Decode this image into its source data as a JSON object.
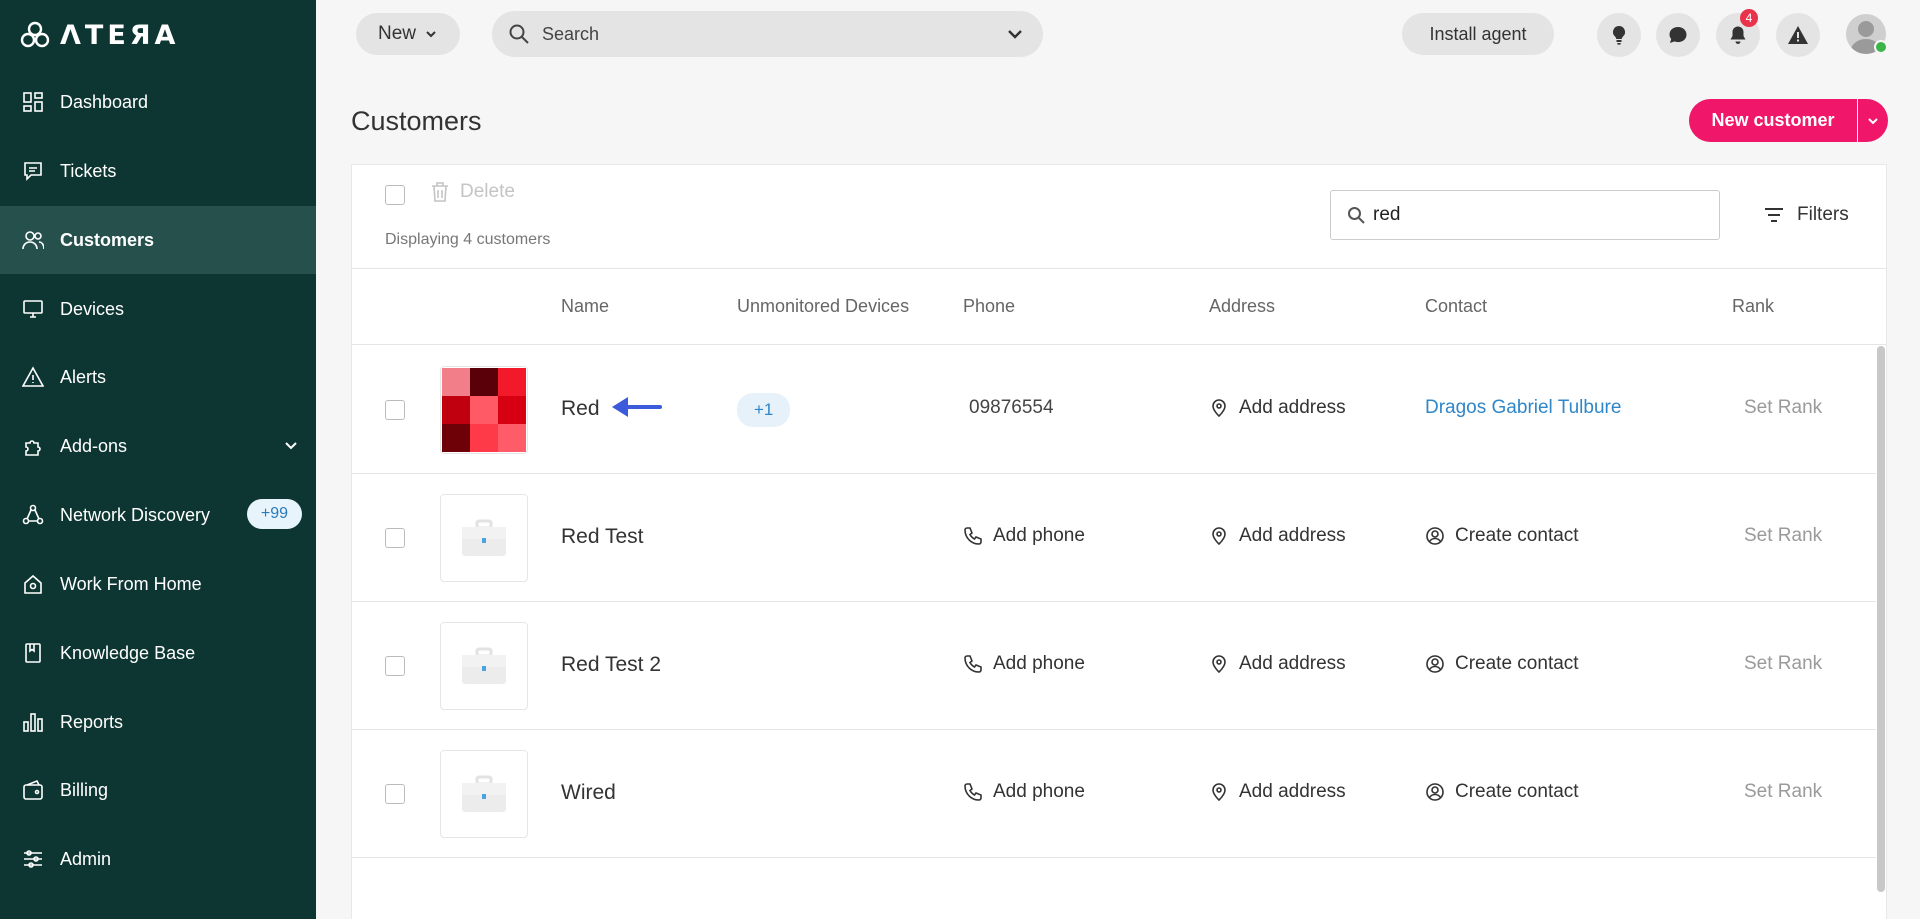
{
  "sidebar": {
    "brand": "ΛTEЯA",
    "items": [
      {
        "label": "Dashboard"
      },
      {
        "label": "Tickets"
      },
      {
        "label": "Customers"
      },
      {
        "label": "Devices"
      },
      {
        "label": "Alerts"
      },
      {
        "label": "Add-ons"
      },
      {
        "label": "Network Discovery",
        "badge": "+99"
      },
      {
        "label": "Work From Home"
      },
      {
        "label": "Knowledge Base"
      },
      {
        "label": "Reports"
      },
      {
        "label": "Billing"
      },
      {
        "label": "Admin"
      }
    ]
  },
  "topbar": {
    "new_label": "New",
    "search_placeholder": "Search",
    "install_label": "Install agent",
    "notif_count": "4"
  },
  "page": {
    "title": "Customers",
    "new_customer_label": "New customer"
  },
  "toolbar": {
    "delete_label": "Delete",
    "displaying": "Displaying 4 customers",
    "search_value": "red",
    "filters_label": "Filters"
  },
  "table": {
    "headers": [
      "Name",
      "Unmonitored Devices",
      "Phone",
      "Address",
      "Contact",
      "Rank"
    ],
    "rows": [
      {
        "name": "Red",
        "unmonitored": "+1",
        "phone": "09876554",
        "address": "Add address",
        "contact": "Dragos Gabriel Tulbure",
        "rank": "Set Rank"
      },
      {
        "name": "Red Test",
        "phone": "Add phone",
        "address": "Add address",
        "contact": "Create contact",
        "rank": "Set Rank"
      },
      {
        "name": "Red Test 2",
        "phone": "Add phone",
        "address": "Add address",
        "contact": "Create contact",
        "rank": "Set Rank"
      },
      {
        "name": "Wired",
        "phone": "Add phone",
        "address": "Add address",
        "contact": "Create contact",
        "rank": "Set Rank"
      }
    ]
  },
  "colors": {
    "sidebar_bg": "#0d3633",
    "sidebar_active": "#25504c",
    "accent": "#f0166a",
    "link": "#2f86c8",
    "arrow": "#3b5bdb"
  }
}
